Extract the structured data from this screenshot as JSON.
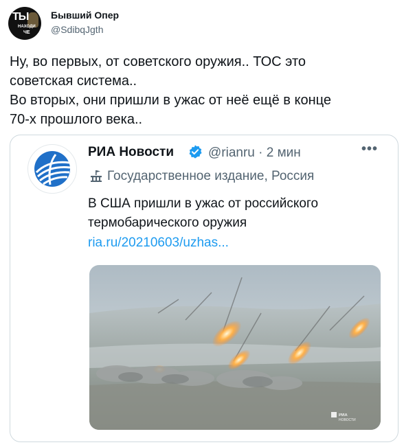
{
  "tweet": {
    "author_name": "Бывший Опер",
    "author_handle": "@SdibqJgth",
    "avatar_text": [
      "ТЫ",
      "НАХОДИ",
      "ЧЕ"
    ],
    "text_lines": [
      "Ну, во первых, от советского оружия.. ТОС это",
      "советская система..",
      "Во вторых, они пришли в ужас от неё ещё в конце",
      "70-х прошлого века.."
    ]
  },
  "quoted_tweet": {
    "author_name": "РИА Новости",
    "handle_time": "@rianru · 2 мин",
    "label": "Государственное издание, Россия",
    "text_lines": [
      "В США пришли в ужас от российского",
      "термобарического оружия"
    ],
    "link": "ria.ru/20210603/uzhas...",
    "media_watermark": [
      "РИА",
      "НОВОСТИ"
    ],
    "more_icon": "more-dots-icon",
    "verified_icon": "verified-badge-icon",
    "label_icon": "government-building-icon",
    "colors": {
      "link": "#1d9bf0",
      "verified": "#1d9bf0",
      "secondary_text": "#536471",
      "ria_logo": "#2070c8"
    }
  }
}
